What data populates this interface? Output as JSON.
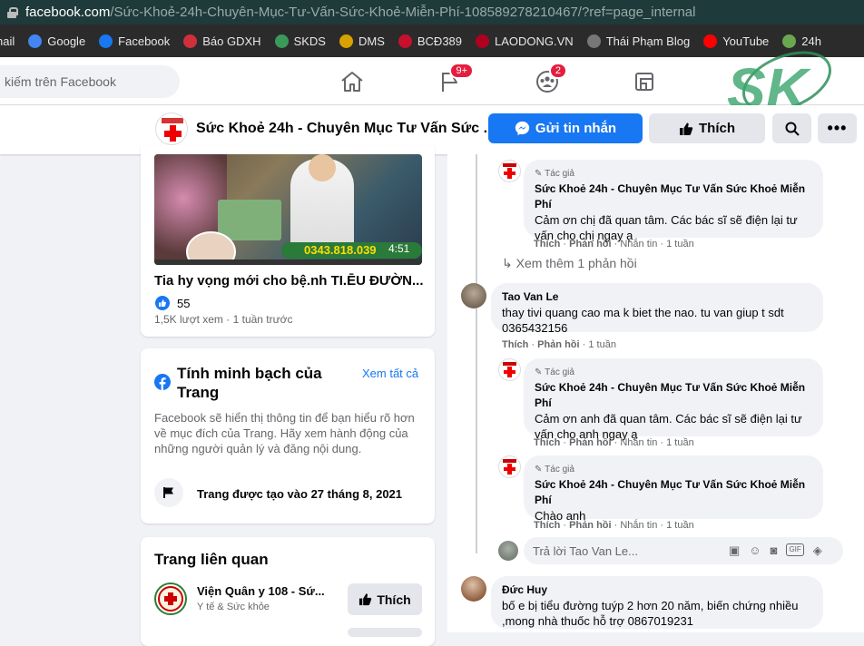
{
  "browser": {
    "url_domain": "facebook.com",
    "url_path": "/Sức-Khoẻ-24h-Chuyên-Mục-Tư-Vấn-Sức-Khoẻ-Miễn-Phí-108589278210467/?ref=page_internal",
    "bookmarks": [
      {
        "label": "nail",
        "icon": "gmail-icon",
        "color": "#ea4335"
      },
      {
        "label": "Google",
        "icon": "google-icon",
        "color": "#4285f4"
      },
      {
        "label": "Facebook",
        "icon": "facebook-icon",
        "color": "#1877f2"
      },
      {
        "label": "Báo GDXH",
        "icon": "gdxh-icon",
        "color": "#d0303c"
      },
      {
        "label": "SKDS",
        "icon": "skds-icon",
        "color": "#3a9a5b"
      },
      {
        "label": "DMS",
        "icon": "dms-icon",
        "color": "#d8a200"
      },
      {
        "label": "BCĐ389",
        "icon": "emblem-icon",
        "color": "#c8102e"
      },
      {
        "label": "LAODONG.VN",
        "icon": "laodong-icon",
        "color": "#b00020"
      },
      {
        "label": "Thái Phạm Blog",
        "icon": "avatar-icon",
        "color": "#777777"
      },
      {
        "label": "YouTube",
        "icon": "youtube-icon",
        "color": "#ff0000"
      },
      {
        "label": "24h",
        "icon": "24h-icon",
        "color": "#6aa84f"
      }
    ]
  },
  "fbnav": {
    "search_placeholder": "kiếm trên Facebook",
    "pages_badge": "9+",
    "groups_badge": "2",
    "watermark": "SK"
  },
  "page_header": {
    "name": "Sức Khoẻ 24h - Chuyên Mục Tư Vấn Sức ...",
    "message_button": "Gửi tin nhắn",
    "like_button": "Thích",
    "accent": "#1877f2"
  },
  "video": {
    "duration": "4:51",
    "phone_overlay": "0343.818.039",
    "title": "Tia hy vọng mới cho bệ.nh TI.ĒU ĐƯỜN...",
    "likes": "55",
    "views": "1,5K lượt xem",
    "time": "1 tuần trước"
  },
  "transparency": {
    "title": "Tính minh bạch của Trang",
    "see_all": "Xem tất cả",
    "description": "Facebook sẽ hiển thị thông tin để bạn hiểu rõ hơn về mục đích của Trang. Hãy xem hành động của những người quản lý và đăng nội dung.",
    "created": "Trang được tạo vào 27 tháng 8, 2021"
  },
  "related": {
    "title": "Trang liên quan",
    "items": [
      {
        "name": "Viện Quân y 108 - Sứ...",
        "category": "Y tế & Sức khỏe",
        "button": "Thích"
      }
    ]
  },
  "comments": {
    "author_tag": "Tác giả",
    "page_author": "Sức Khoẻ 24h - Chuyên Mục Tư Vấn Sức Khoẻ Miễn Phí",
    "like": "Thích",
    "reply": "Phản hồi",
    "sent": "Nhắn tin",
    "reply_1_text": "Cảm ơn chị đã quan tâm. Các bác sĩ sẽ điện lại tư vấn cho chị ngay ạ",
    "reply_1_time": "1 tuần",
    "see_more": "Xem thêm 1 phản hồi",
    "c2_author": "Tao Van Le",
    "c2_text": "thay tivi quang cao ma k biet the nao. tu van giup t sdt 0365432156",
    "c2_time": "1 tuần",
    "reply_2_text": "Cảm ơn anh đã quan tâm. Các bác sĩ sẽ điện lại tư vấn cho anh ngay ạ",
    "reply_2_time": "1 tuần",
    "reply_3_text": "Chào anh",
    "reply_3_time": "1 tuần",
    "reply_placeholder": "Trả lời Tao Van Le...",
    "c3_author": "Đức Huy",
    "c3_text": "bố e bị tiểu đường tuýp 2 hơn 20 năm, biến chứng nhiều ,mong nhà thuốc hỗ trợ 0867019231"
  }
}
